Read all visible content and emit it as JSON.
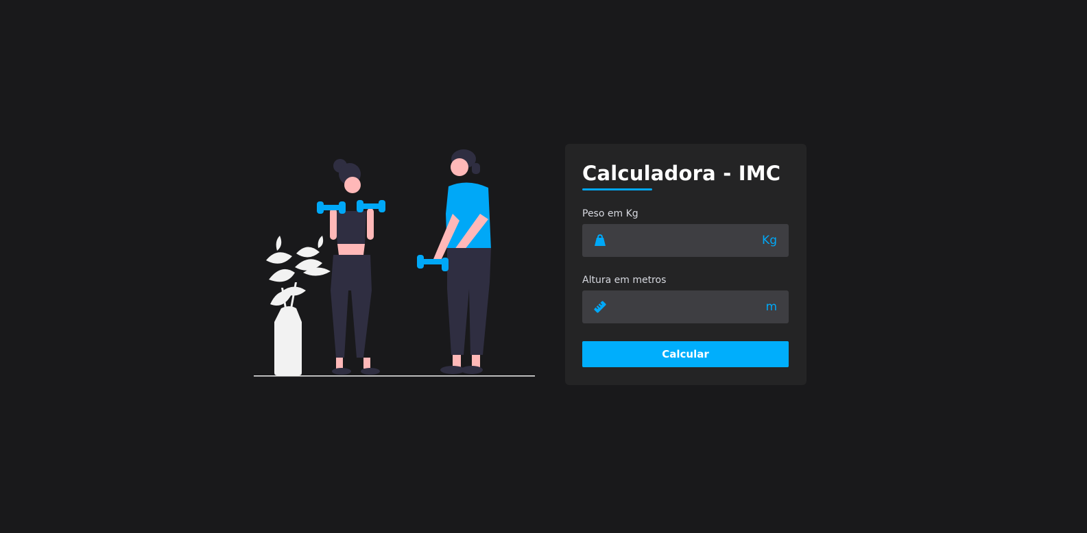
{
  "calculator": {
    "title": "Calculadora - IMC",
    "weight": {
      "label": "Peso em Kg",
      "value": "",
      "placeholder": "",
      "unit": "Kg",
      "icon": "weight-icon"
    },
    "height": {
      "label": "Altura em metros",
      "value": "",
      "placeholder": "",
      "unit": "m",
      "icon": "ruler-icon"
    },
    "button_label": "Calcular"
  },
  "colors": {
    "background": "#19191b",
    "card": "#242425",
    "input": "#3e3e42",
    "accent": "#00a8f7",
    "text": "#ffffff"
  }
}
